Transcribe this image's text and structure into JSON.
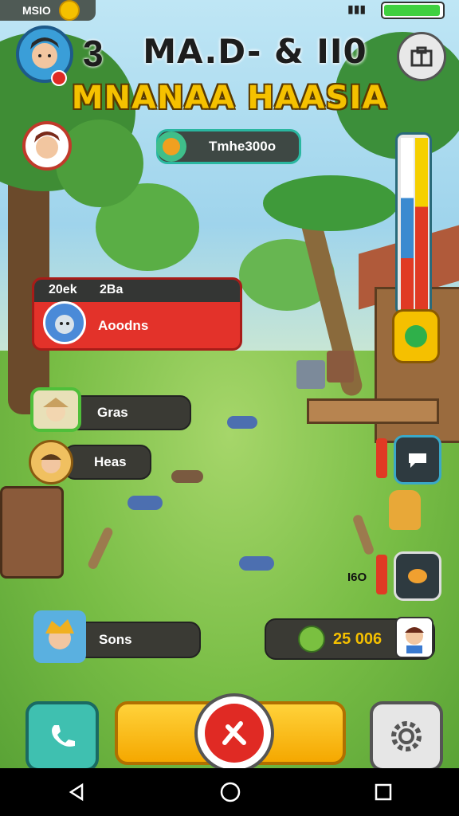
{
  "status_bar": {
    "left_text": "MSIO"
  },
  "header": {
    "level": "3",
    "title_line1": "MA.D- & II0",
    "title_line2": "MNANAA HAASIA"
  },
  "resource_pill": {
    "label": "Tmhe300o"
  },
  "players": [
    {
      "count": "20ek",
      "tag": "2Ba",
      "name": "Aoodns",
      "highlight": true
    },
    {
      "name": "Gras"
    },
    {
      "name": "Heas"
    },
    {
      "name": "Sons"
    }
  ],
  "right_panel": {
    "small_label": "I6O",
    "coins": "25 006"
  },
  "bottom_bar": {
    "left_icon": "phone-icon",
    "center_icon": "sword-icon",
    "right_icon": "gear-icon"
  },
  "colors": {
    "accent_yellow": "#f5b800",
    "red": "#e02a24",
    "teal": "#3fb8a8",
    "panel_dark": "#3a3a34"
  },
  "navbar": {
    "back": "back-icon",
    "home": "home-icon",
    "recents": "recents-icon"
  }
}
